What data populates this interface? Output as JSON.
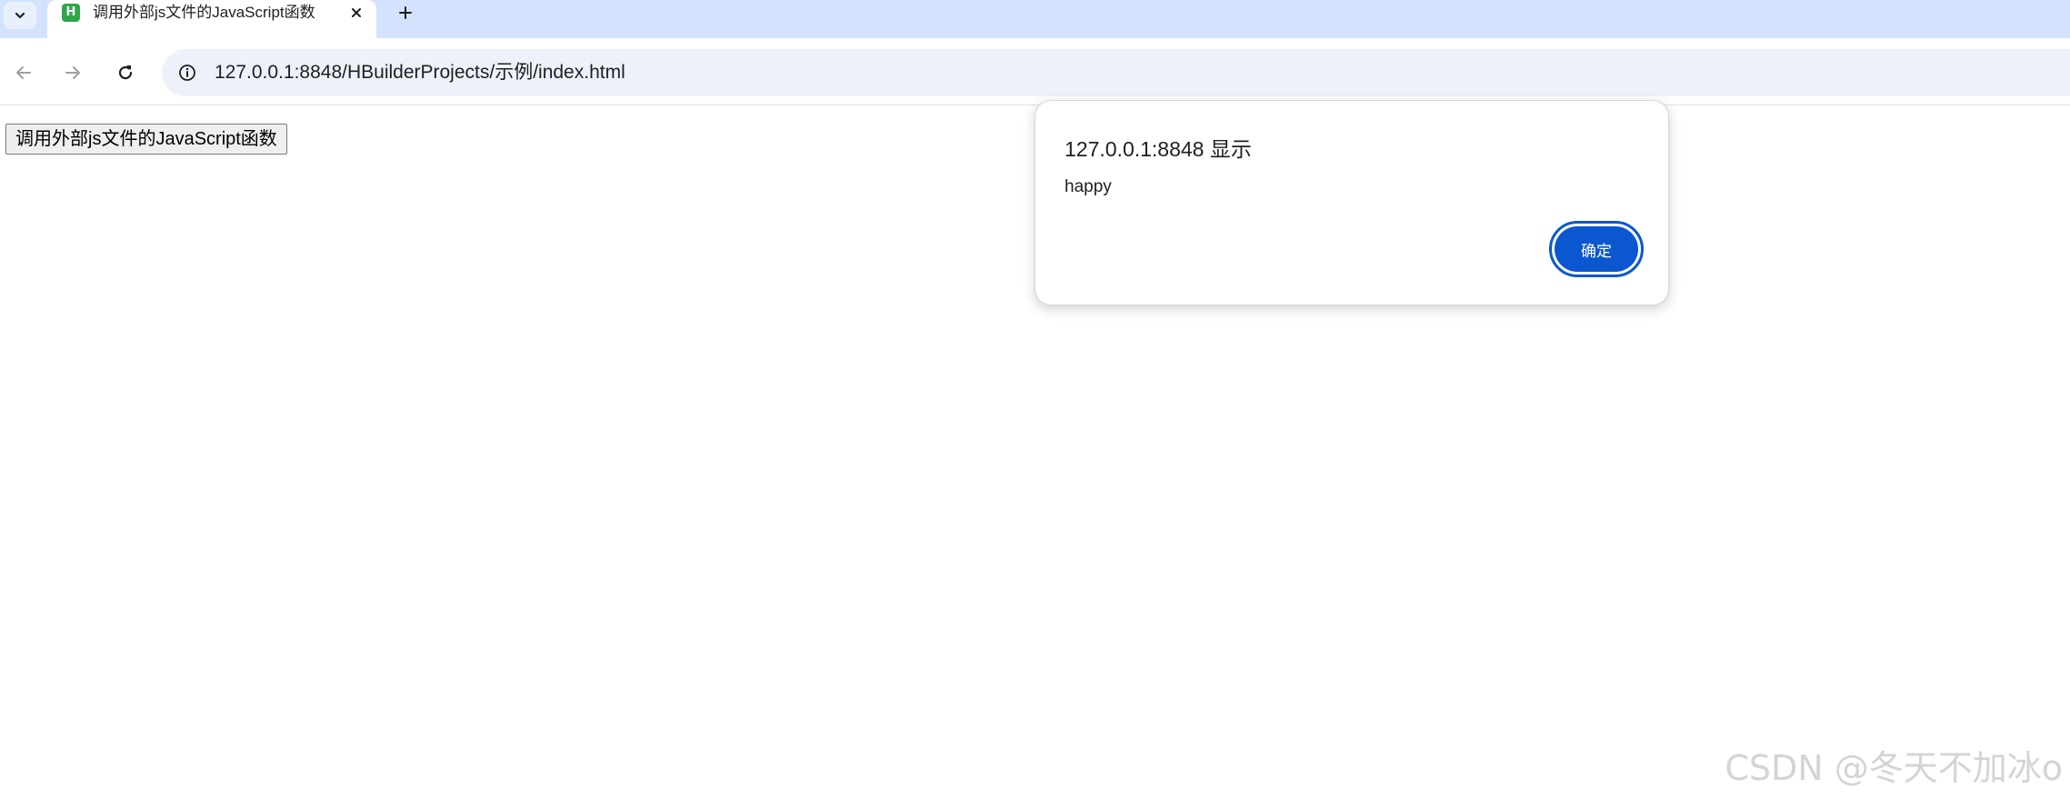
{
  "browser": {
    "tab": {
      "title": "调用外部js文件的JavaScript函数",
      "favicon_letter": "H",
      "favicon_color": "#2fa64a"
    },
    "address_bar": {
      "url": "127.0.0.1:8848/HBuilderProjects/示例/index.html"
    },
    "icons": {
      "tab_menu": "chevron-down-icon",
      "tab_close": "close-icon",
      "new_tab": "plus-icon",
      "back": "arrow-left-icon",
      "forward": "arrow-right-icon",
      "reload": "reload-icon",
      "site_info": "info-icon"
    },
    "colors": {
      "tabbar_bg": "#d3e3fd",
      "omnibox_bg": "#edf2fa",
      "accent": "#0b57d0"
    }
  },
  "page": {
    "button_label": "调用外部js文件的JavaScript函数"
  },
  "alert": {
    "title": "127.0.0.1:8848 显示",
    "message": "happy",
    "ok_label": "确定"
  },
  "watermark": {
    "text": "CSDN @冬天不加冰o"
  }
}
